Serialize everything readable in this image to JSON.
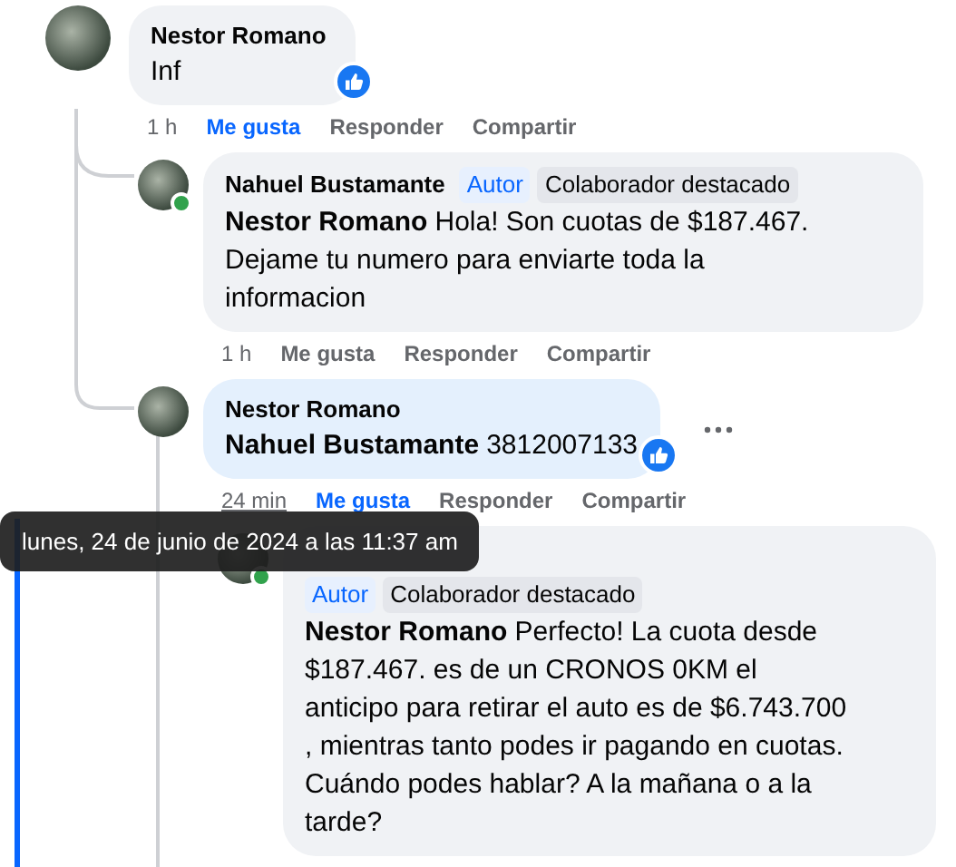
{
  "comments": [
    {
      "author": "Nestor Romano",
      "text": "Inf",
      "reacted": true,
      "time": "1 h",
      "like_label": "Me gusta",
      "liked": true,
      "reply_label": "Responder",
      "share_label": "Compartir",
      "replies": [
        {
          "author": "Nahuel Bustamante",
          "badges": [
            {
              "label": "Autor",
              "kind": "author"
            },
            {
              "label": "Colaborador destacado",
              "kind": "contributor"
            }
          ],
          "mention": "Nestor Romano",
          "text": "Hola! Son cuotas de $187.467. Dejame tu numero para enviarte toda la informacion",
          "online": true,
          "time": "1 h",
          "like_label": "Me gusta",
          "liked": false,
          "reply_label": "Responder",
          "share_label": "Compartir"
        },
        {
          "author": "Nestor Romano",
          "mention": "Nahuel Bustamante",
          "text": "3812007133",
          "reacted": true,
          "highlighted": true,
          "time": "24 min",
          "time_hovered": true,
          "like_label": "Me gusta",
          "liked": true,
          "reply_label": "Responder",
          "share_label": "Compartir",
          "more_button": true,
          "replies": [
            {
              "badges": [
                {
                  "label": "Autor",
                  "kind": "author"
                },
                {
                  "label": "Colaborador destacado",
                  "kind": "contributor"
                }
              ],
              "mention": "Nestor Romano",
              "text": "Perfecto! La cuota desde $187.467. es de un CRONOS 0KM el anticipo para retirar el auto es de $6.743.700 , mientras tanto podes ir pagando en cuotas. Cuándo podes hablar? A la mañana o a la tarde?",
              "online": true,
              "focused": true
            }
          ]
        }
      ]
    }
  ],
  "tooltip": "lunes, 24 de junio de 2024 a las 11:37 am"
}
